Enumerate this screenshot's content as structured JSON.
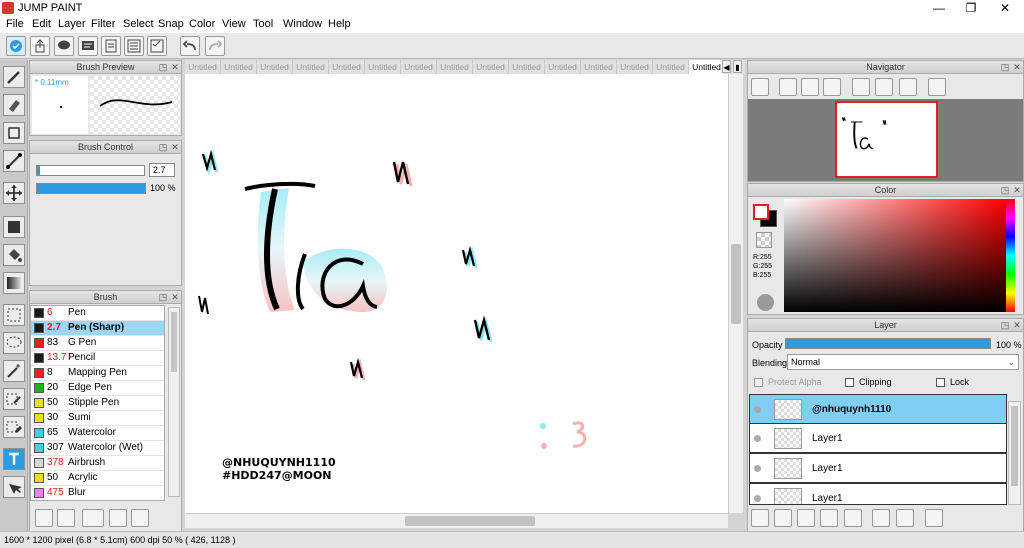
{
  "app": {
    "title": "JUMP PAINT"
  },
  "window_controls": {
    "minimize": "—",
    "maximize": "❐",
    "close": "✕"
  },
  "menu": [
    "File",
    "Edit",
    "Layer",
    "Filter",
    "Select",
    "Snap",
    "Color",
    "View",
    "Tool",
    "Window",
    "Help"
  ],
  "panels": {
    "brush_preview": {
      "title": "Brush Preview",
      "size": "* 0.11mm"
    },
    "brush_control": {
      "title": "Brush Control",
      "size_value": "2.7",
      "opacity_value": "100 %"
    },
    "brush": {
      "title": "Brush"
    },
    "navigator": {
      "title": "Navigator"
    },
    "color": {
      "title": "Color",
      "r": "R:255",
      "g": "G:255",
      "b": "B:255"
    },
    "layer": {
      "title": "Layer",
      "opacity_label": "Opacity",
      "opacity_value": "100 %",
      "blending_label": "Blending",
      "blending_value": "Normal",
      "protect_alpha": "Protect Alpha",
      "clipping": "Clipping",
      "lock": "Lock"
    }
  },
  "brushes": [
    {
      "size": "6",
      "name": "Pen",
      "color": "#1a1a1a",
      "red": true
    },
    {
      "size": "2.7",
      "name": "Pen (Sharp)",
      "color": "#1a1a1a",
      "red": true,
      "selected": true
    },
    {
      "size": "83",
      "name": "G Pen",
      "color": "#e82020",
      "red": false
    },
    {
      "size": "13.7",
      "name": "Pencil",
      "color": "#1a1a1a",
      "red": true
    },
    {
      "size": "8",
      "name": "Mapping Pen",
      "color": "#e82020",
      "red": false
    },
    {
      "size": "20",
      "name": "Edge Pen",
      "color": "#20b020",
      "red": false
    },
    {
      "size": "50",
      "name": "Stipple Pen",
      "color": "#e8e020",
      "red": false
    },
    {
      "size": "30",
      "name": "Sumi",
      "color": "#e8e020",
      "red": false
    },
    {
      "size": "65",
      "name": "Watercolor",
      "color": "#40d0e0",
      "red": false
    },
    {
      "size": "307",
      "name": "Watercolor (Wet)",
      "color": "#40d0e0",
      "red": false
    },
    {
      "size": "378",
      "name": "Airbrush",
      "color": "#d8d8d8",
      "red": true
    },
    {
      "size": "50",
      "name": "Acrylic",
      "color": "#e8e020",
      "red": false
    },
    {
      "size": "475",
      "name": "Blur",
      "color": "#f080f0",
      "red": true
    }
  ],
  "tabs": [
    "Untitled",
    "Untitled",
    "Untitled",
    "Untitled",
    "Untitled",
    "Untitled",
    "Untitled",
    "Untitled",
    "Untitled",
    "Untitled",
    "Untitled",
    "Untitled",
    "Untitled",
    "Untitled",
    "Untitled"
  ],
  "canvas_text": {
    "line1": "@NHUQUYNH1110",
    "line2": "#HDD247@MOON"
  },
  "layers": [
    {
      "name": "@nhuquynh1110",
      "selected": true
    },
    {
      "name": "Layer1",
      "selected": false
    },
    {
      "name": "Layer1",
      "selected": false
    },
    {
      "name": "Layer1",
      "selected": false
    }
  ],
  "status": {
    "text": "1600 * 1200 pixel   (6.8 * 5.1cm)   600 dpi   50 %   ( 426, 1128 )"
  },
  "colors": {
    "accent": "#2d9be0",
    "selected_row": "#9dd5f5",
    "layer_selected": "#7fcff2"
  }
}
